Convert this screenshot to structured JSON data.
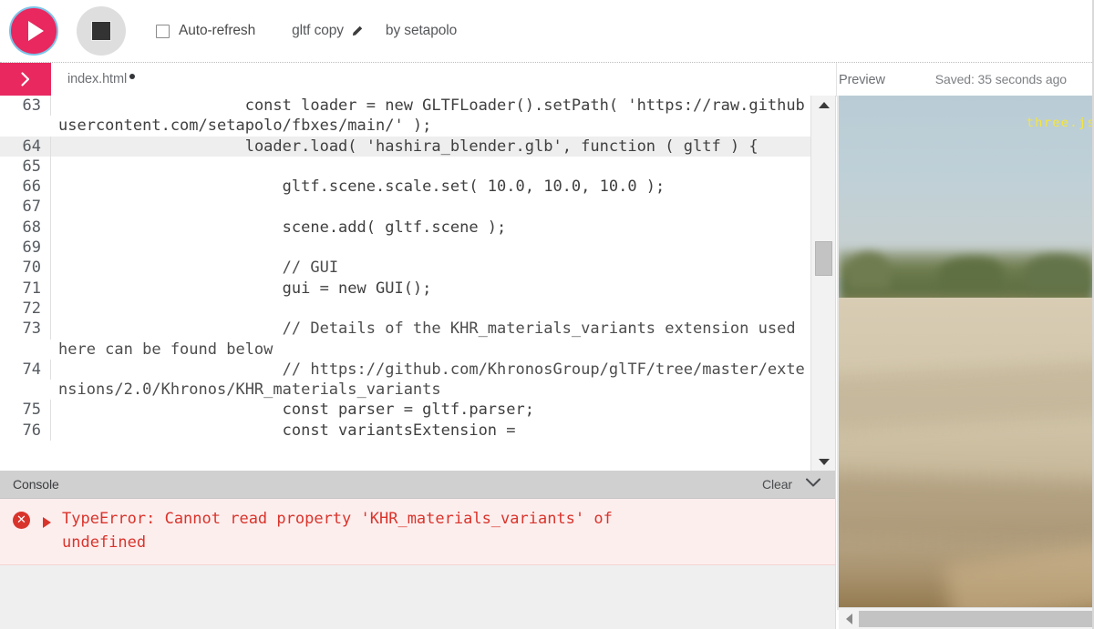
{
  "toolbar": {
    "run_label": "run-button",
    "stop_label": "stop-button",
    "autorefresh_label": "Auto-refresh",
    "project_name": "gltf copy",
    "byline": "by setapolo"
  },
  "tabs": {
    "expand_chevron": "›",
    "file_name": "index.html",
    "unsaved_marker": "●",
    "saved_status": "Saved: 35 seconds ago",
    "preview_label": "Preview"
  },
  "editor": {
    "lines": [
      {
        "number": "63",
        "text": "                    const loader = new GLTFLoader().setPath( 'https://raw.githubusercontent.com/setapolo/fbxes/main/' );",
        "alt": false
      },
      {
        "number": "64",
        "text": "                    loader.load( 'hashira_blender.glb', function ( gltf ) {",
        "alt": true
      },
      {
        "number": "65",
        "text": "",
        "alt": false
      },
      {
        "number": "66",
        "text": "                        gltf.scene.scale.set( 10.0, 10.0, 10.0 );",
        "alt": false
      },
      {
        "number": "67",
        "text": "",
        "alt": false
      },
      {
        "number": "68",
        "text": "                        scene.add( gltf.scene );",
        "alt": false
      },
      {
        "number": "69",
        "text": "",
        "alt": false
      },
      {
        "number": "70",
        "text": "                        // GUI",
        "alt": false
      },
      {
        "number": "71",
        "text": "                        gui = new GUI();",
        "alt": false
      },
      {
        "number": "72",
        "text": "",
        "alt": false
      },
      {
        "number": "73",
        "text": "                        // Details of the KHR_materials_variants extension used here can be found below",
        "alt": false
      },
      {
        "number": "74",
        "text": "                        // https://github.com/KhronosGroup/glTF/tree/master/extensions/2.0/Khronos/KHR_materials_variants",
        "alt": false
      },
      {
        "number": "75",
        "text": "                        const parser = gltf.parser;",
        "alt": false
      },
      {
        "number": "76",
        "text": "                        const variantsExtension =",
        "alt": false
      }
    ]
  },
  "console": {
    "title": "Console",
    "clear_label": "Clear",
    "collapse_icon": "chevron-down-icon",
    "messages": [
      {
        "level": "error",
        "badge": "✕",
        "text": "TypeError: Cannot read property 'KHR_materials_variants' of undefined"
      }
    ]
  },
  "preview": {
    "overlay_text": "three.js",
    "overlay_color": "#f5e63c"
  },
  "colors": {
    "accent": "#e8285e",
    "error": "#d9342b",
    "console_header": "#d0d0d0",
    "error_bg": "#fdeeee"
  }
}
